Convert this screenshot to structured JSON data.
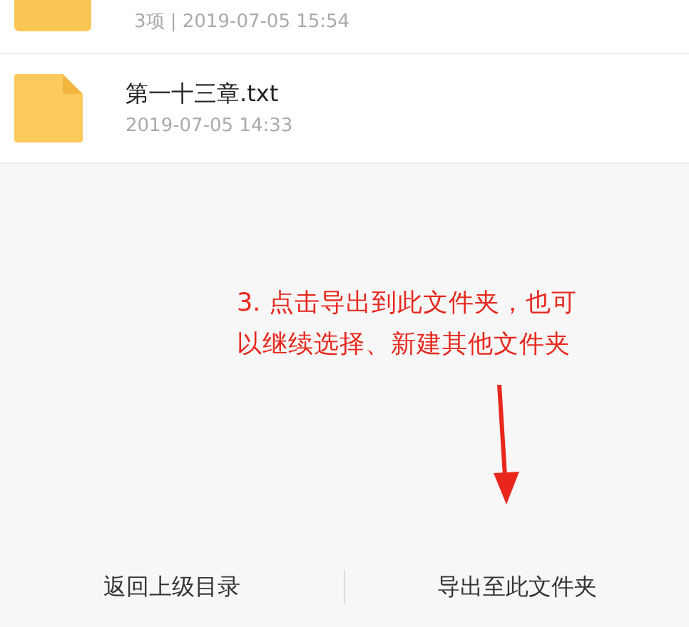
{
  "files": [
    {
      "kind": "folder",
      "meta": "3项 | 2019-07-05 15:54"
    },
    {
      "kind": "file",
      "name": "第一十三章.txt",
      "meta": "2019-07-05 14:33"
    }
  ],
  "annotation": {
    "lines": [
      "3. 点击导出到此文件夹，也可",
      "以继续选择、新建其他文件夹"
    ]
  },
  "bottom_bar": {
    "buttons": [
      "返回上级目录",
      "导出至此文件夹"
    ]
  }
}
